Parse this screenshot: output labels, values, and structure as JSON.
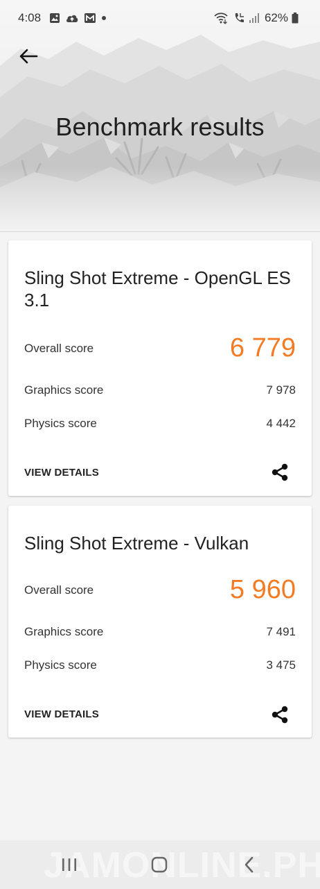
{
  "status_bar": {
    "time": "4:08",
    "battery_percent": "62%",
    "left_icons": [
      "image-icon",
      "cloud-upload-icon",
      "gmail-icon",
      "dot-icon"
    ],
    "right_icons": [
      "wifi-call-icon",
      "call-icon",
      "signal-icon",
      "battery-icon"
    ]
  },
  "header": {
    "title": "Benchmark results",
    "back_icon": "arrow-left-icon"
  },
  "results": [
    {
      "title": "Sling Shot Extreme - OpenGL ES 3.1",
      "overall_label": "Overall score",
      "overall_value": "6 779",
      "graphics_label": "Graphics score",
      "graphics_value": "7 978",
      "physics_label": "Physics score",
      "physics_value": "4 442",
      "details_label": "VIEW DETAILS",
      "share_icon": "share-icon"
    },
    {
      "title": "Sling Shot Extreme - Vulkan",
      "overall_label": "Overall score",
      "overall_value": "5 960",
      "graphics_label": "Graphics score",
      "graphics_value": "7 491",
      "physics_label": "Physics score",
      "physics_value": "3 475",
      "details_label": "VIEW DETAILS",
      "share_icon": "share-icon"
    }
  ],
  "nav_bar": {
    "buttons": [
      "recents-icon",
      "home-icon",
      "back-chevron-icon"
    ],
    "watermark": "JAMONLINE.PH"
  },
  "colors": {
    "accent": "#f37b23",
    "background": "#f4f4f4",
    "card": "#ffffff",
    "text": "#222222"
  }
}
